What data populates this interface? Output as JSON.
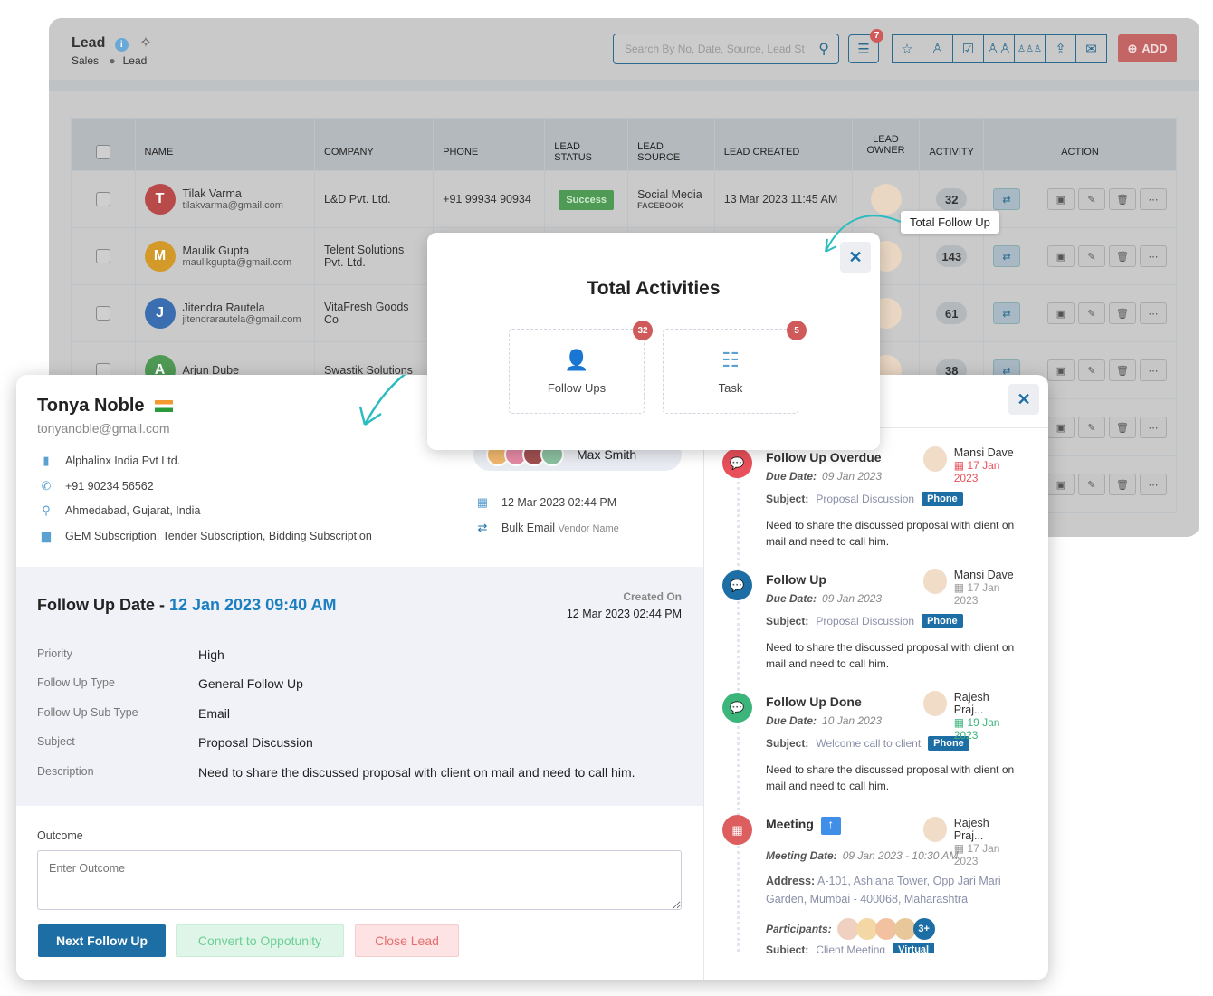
{
  "header": {
    "title": "Lead",
    "breadcrumb": [
      "Sales",
      "Lead"
    ],
    "search_placeholder": "Search By No, Date, Source, Lead St",
    "filter_count": "7",
    "add_label": "ADD"
  },
  "table": {
    "columns": [
      "NAME",
      "COMPANY",
      "PHONE",
      "LEAD STATUS",
      "LEAD SOURCE",
      "LEAD CREATED",
      "LEAD OWNER",
      "ACTIVITY",
      "ACTION"
    ],
    "rows": [
      {
        "initial": "T",
        "color": "#b84a4a",
        "name": "Tilak Varma",
        "email": "tilakvarma@gmail.com",
        "company": "L&D Pvt. Ltd.",
        "phone": "+91 99934 90934",
        "status": "Success",
        "source": "Social Media",
        "source_sub": "FACEBOOK",
        "created": "13 Mar 2023 11:45 AM",
        "activity": "32"
      },
      {
        "initial": "M",
        "color": "#d39a2a",
        "name": "Maulik Gupta",
        "email": "maulikgupta@gmail.com",
        "company": "Telent Solutions Pvt. Ltd.",
        "phone": "",
        "status": "",
        "source": "",
        "source_sub": "",
        "created": "",
        "activity": "143"
      },
      {
        "initial": "J",
        "color": "#3a6eb0",
        "name": "Jitendra Rautela",
        "email": "jitendrarautela@gmail.com",
        "company": "VitaFresh Goods Co",
        "phone": "",
        "status": "",
        "source": "",
        "source_sub": "",
        "created": "",
        "activity": "61"
      },
      {
        "initial": "A",
        "color": "#4f9a55",
        "name": "Arjun Dube",
        "email": "",
        "company": "Swastik Solutions",
        "phone": "",
        "status": "",
        "source": "",
        "source_sub": "",
        "created": "",
        "activity": "38"
      },
      {
        "initial": "",
        "color": "",
        "name": "",
        "email": "",
        "company": "",
        "phone": "",
        "status": "",
        "source": "",
        "source_sub": "",
        "created": "",
        "activity": ""
      },
      {
        "initial": "",
        "color": "",
        "name": "",
        "email": "",
        "company": "",
        "phone": "",
        "status": "",
        "source": "",
        "source_sub": "",
        "created": "",
        "activity": ""
      }
    ]
  },
  "tooltip": "Total Follow Up",
  "popup": {
    "title": "Total Activities",
    "items": [
      {
        "label": "Follow Ups",
        "count": "32"
      },
      {
        "label": "Task",
        "count": "5"
      }
    ]
  },
  "contact": {
    "name": "Tonya Noble",
    "email": "tonyanoble@gmail.com",
    "company": "Alphalinx India Pvt Ltd.",
    "phone": "+91 90234 56562",
    "location": "Ahmedabad, Gujarat, India",
    "subscriptions": "GEM Subscription, Tender Subscription, Bidding Subscription",
    "owner": "Max Smith",
    "created": "12 Mar 2023 02:44 PM",
    "source": "Bulk Email",
    "source_sub": "Vendor Name"
  },
  "followup": {
    "label": "Follow Up Date - ",
    "date": "12 Jan 2023 09:40 AM",
    "created_label": "Created On",
    "created": "12 Mar 2023 02:44 PM",
    "fields": [
      {
        "k": "Priority",
        "v": "High"
      },
      {
        "k": "Follow Up Type",
        "v": "General Follow Up"
      },
      {
        "k": "Follow Up Sub Type",
        "v": "Email"
      },
      {
        "k": "Subject",
        "v": "Proposal Discussion"
      },
      {
        "k": "Description",
        "v": "Need to share the discussed proposal with client on mail and need to call him."
      }
    ],
    "outcome_label": "Outcome",
    "outcome_placeholder": "Enter Outcome",
    "buttons": [
      "Next Follow Up",
      "Convert to Oppotunity",
      "Close Lead"
    ]
  },
  "timeline": [
    {
      "title": "Follow Up Overdue",
      "color": "#e8505b",
      "date_label": "Due Date:",
      "date": "09 Jan 2023",
      "user": "Mansi Dave",
      "user_date": "17 Jan 2023",
      "user_date_color": "#e8505b",
      "subject": "Proposal Discussion",
      "tag": "Phone",
      "desc": "Need to share the discussed proposal with client on mail and need to call him."
    },
    {
      "title": "Follow Up",
      "color": "#1c6ea4",
      "date_label": "Due Date:",
      "date": "09 Jan 2023",
      "user": "Mansi Dave",
      "user_date": "17 Jan 2023",
      "user_date_color": "#999",
      "subject": "Proposal Discussion",
      "tag": "Phone",
      "desc": "Need to share the discussed proposal with client on mail and need to call him."
    },
    {
      "title": "Follow Up Done",
      "color": "#3cb57a",
      "date_label": "Due Date:",
      "date": "10 Jan 2023",
      "user": "Rajesh Praj...",
      "user_date": "19 Jan 2023",
      "user_date_color": "#3cb57a",
      "subject": "Welcome call to client",
      "tag": "Phone",
      "desc": "Need to share the discussed proposal with client on mail and need to call him."
    }
  ],
  "meeting": {
    "title": "Meeting",
    "user": "Rajesh Praj...",
    "user_date": "17 Jan 2023",
    "date_label": "Meeting Date:",
    "date": "09 Jan 2023 - 10:30 AM",
    "address_label": "Address:",
    "address": "A-101, Ashiana Tower, Opp Jari Mari Garden, Mumbai - 400068, Maharashtra",
    "participants_label": "Participants:",
    "participants_more": "3+",
    "subject_label": "Subject:",
    "subject": "Client Meeting",
    "tag": "Virtual"
  },
  "labels": {
    "subject": "Subject:"
  }
}
